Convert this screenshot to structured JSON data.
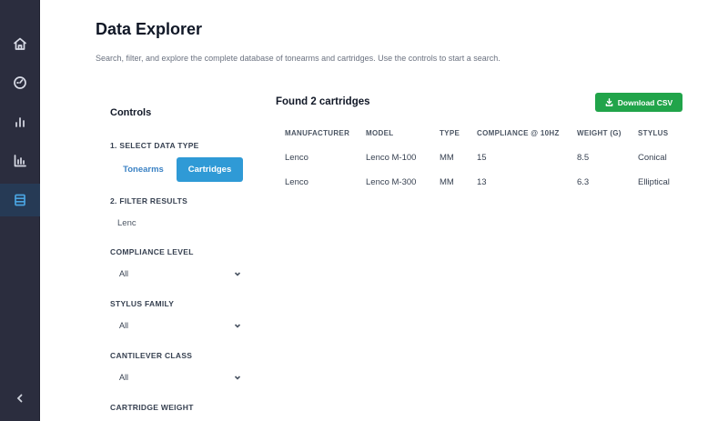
{
  "header": {
    "title": "Data Explorer",
    "description": "Search, filter, and explore the complete database of tonearms and cartridges. Use the controls to start a search."
  },
  "sidebar": {
    "icons": [
      "home-icon",
      "gauge-icon",
      "bar-chart-icon",
      "chart-axis-icon",
      "database-icon"
    ],
    "collapse_icon": "chevron-left-icon"
  },
  "controls": {
    "title": "Controls",
    "select_type_label": "1. SELECT DATA TYPE",
    "types": [
      "Tonearms",
      "Cartridges"
    ],
    "selected_type": "Cartridges",
    "filter_label": "2. FILTER RESULTS",
    "filter_value": "Lenc",
    "compliance_label": "COMPLIANCE LEVEL",
    "compliance_value": "All",
    "stylus_label": "STYLUS FAMILY",
    "stylus_value": "All",
    "cantilever_label": "CANTILEVER CLASS",
    "cantilever_value": "All",
    "weight_label": "CARTRIDGE WEIGHT"
  },
  "results": {
    "title": "Found 2 cartridges",
    "download_label": "Download CSV",
    "columns": [
      "MANUFACTURER",
      "MODEL",
      "TYPE",
      "COMPLIANCE @ 10HZ",
      "WEIGHT (G)",
      "STYLUS"
    ],
    "rows": [
      [
        "Lenco",
        "Lenco M-100",
        "MM",
        "15",
        "8.5",
        "Conical"
      ],
      [
        "Lenco",
        "Lenco M-300",
        "MM",
        "13",
        "6.3",
        "Elliptical"
      ]
    ]
  },
  "colors": {
    "sidebar": "#2b2d3e",
    "accent": "#2f9ad6",
    "download": "#21a44a"
  }
}
